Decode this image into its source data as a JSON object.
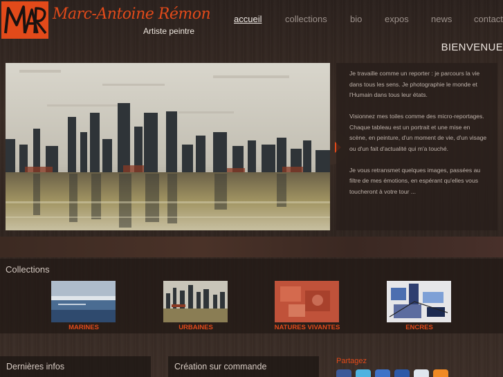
{
  "logo": {
    "mark": "MAR",
    "name": "Marc-Antoine Rémon",
    "subtitle": "Artiste peintre"
  },
  "nav": {
    "items": [
      "accueil",
      "collections",
      "bio",
      "expos",
      "news",
      "contact"
    ],
    "active": "accueil"
  },
  "welcome": "BIENVENUE",
  "intro": {
    "p1": "Je travaille comme un reporter : je parcours la vie dans tous les sens. Je photographie le monde et l'Humain dans tous leur états.",
    "p2": "Visionnez mes toiles comme des micro-reportages. Chaque tableau est un portrait et une mise en scène, en peinture, d'un moment de vie, d'un visage ou d'un fait d'actualité qui m'a touché.",
    "p3": "Je vous retransmet quelques images, passées au filtre de mes émotions, en espérant qu'elles vous toucheront à votre tour ..."
  },
  "collections": {
    "title": "Collections",
    "items": [
      {
        "label": "MARINES"
      },
      {
        "label": "URBAINES"
      },
      {
        "label": "NATURES VIVANTES"
      },
      {
        "label": "ENCRES"
      }
    ]
  },
  "panels": {
    "news": "Dernières infos",
    "commission": "Création sur commande"
  },
  "share": {
    "title": "Partagez",
    "icons": [
      "facebook-icon",
      "twitter-icon",
      "delicious-icon",
      "myspace-icon",
      "google-icon",
      "rss-icon"
    ],
    "colors": [
      "#3b5998",
      "#4fb3e0",
      "#3e73c8",
      "#2c5aa8",
      "#dfe6ee",
      "#f08a24"
    ]
  },
  "colors": {
    "accent": "#e24a1a"
  }
}
